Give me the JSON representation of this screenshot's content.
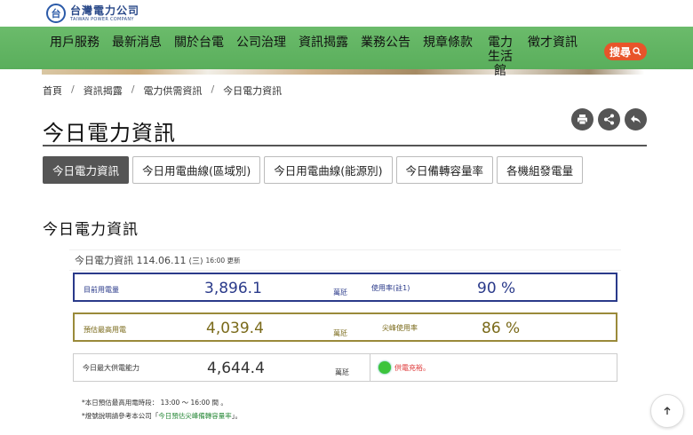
{
  "header": {
    "logo_cn": "台灣電力公司",
    "logo_en": "TAIWAN POWER COMPANY",
    "logo_mark": "台"
  },
  "nav": {
    "items": [
      "用戶服務",
      "最新消息",
      "關於台電",
      "公司治理",
      "資訊揭露",
      "業務公告",
      "規章條款",
      "電力生活館",
      "徵才資訊"
    ],
    "search_label": "搜尋",
    "search_icon": "magnifier-icon",
    "accent_color": "#5fb35f",
    "search_color": "#e8542a"
  },
  "breadcrumb": [
    "首頁",
    "資訊揭露",
    "電力供需資訊",
    "今日電力資訊"
  ],
  "page_title": "今日電力資訊",
  "action_icons": [
    "print-icon",
    "share-icon",
    "back-icon"
  ],
  "tabs": [
    "今日電力資訊",
    "今日用電曲線(區域別)",
    "今日用電曲線(能源別)",
    "今日備轉容量率",
    "各機組發電量"
  ],
  "section_title": "今日電力資訊",
  "panel": {
    "header_prefix": "今日電力資訊 114.06.11",
    "header_weekday": "(三)",
    "header_time": "16:00 更新",
    "rows": [
      {
        "label": "目前用電量",
        "value": "3,896.1",
        "unit": "萬瓩",
        "label2": "使用率(註1)",
        "pct": "90 %",
        "color": "#2a3a8a"
      },
      {
        "label": "預估最高用電",
        "value": "4,039.4",
        "unit": "萬瓩",
        "label2": "尖峰使用率",
        "pct": "86 %",
        "color": "#9a8a3a"
      },
      {
        "label": "今日最大供電能力",
        "value": "4,644.4",
        "unit": "萬瓩",
        "status": "供電充裕",
        "status_color": "#3cc43c"
      }
    ]
  },
  "notes": {
    "line1": "*本日預估最高用電時段： 13:00 ～ 16:00 間 。",
    "line2_prefix": "*燈號說明請參考本公司「",
    "line2_link": "今日預估尖峰備轉容量率",
    "line2_suffix": "」。"
  },
  "back_to_top_icon": "arrow-up-icon"
}
